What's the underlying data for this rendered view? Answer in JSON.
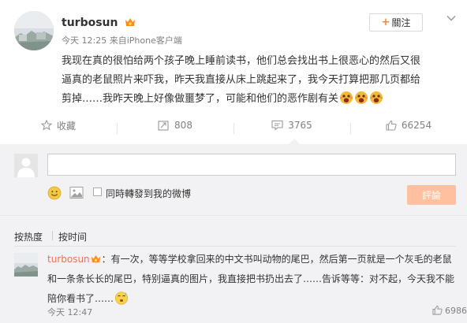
{
  "post": {
    "username": "turbosun",
    "time": "今天 12:25",
    "source_prefix": " 来自",
    "client": "iPhone客户端",
    "follow_label": "關注",
    "text_line1": "我现在真的很怕给两个孩子晚上睡前读书，他们总会找出书上很恶心的然后又很",
    "text_line2": "逼真的老鼠照片来吓我，昨天我直接从床上跳起来了，我今天打算把那几页都给",
    "text_line3": "剪掉……我昨天晚上好像做噩梦了，可能和他们的恶作剧有关"
  },
  "actions": {
    "collect_label": "收藏",
    "repost_count": "808",
    "comment_count": "3765",
    "like_count": "66254"
  },
  "composer": {
    "input_value": "",
    "repost_option_label": "同時轉發到我的微博",
    "submit_label": "評論"
  },
  "sort": {
    "hot_label": "按热度",
    "time_label": "按时间"
  },
  "comment": {
    "username": "turbosun",
    "line1": "：有一次，等等学校拿回来的中文书叫动物的尾巴，然后第一页就是一个灰毛的老鼠",
    "line2": "和一条条长长的尾巴，特别逼真的图片，我直接把书扔出去了……告诉等等：对不起，今天我不能",
    "line3": "陪你看书了……",
    "time": "今天 12:47",
    "like_count": "6986"
  },
  "colors": {
    "accent_orange": "#ff8140",
    "submit_disabled": "#ffc09f",
    "comment_name": "#eb7350",
    "panel_bg": "#f2f2f5"
  },
  "icons": [
    "vip-icon",
    "chevron-down-icon",
    "star-icon",
    "repost-icon",
    "comment-icon",
    "like-icon",
    "screaming-face-emoji",
    "sweat-face-emoji",
    "smiley-icon",
    "image-icon"
  ]
}
